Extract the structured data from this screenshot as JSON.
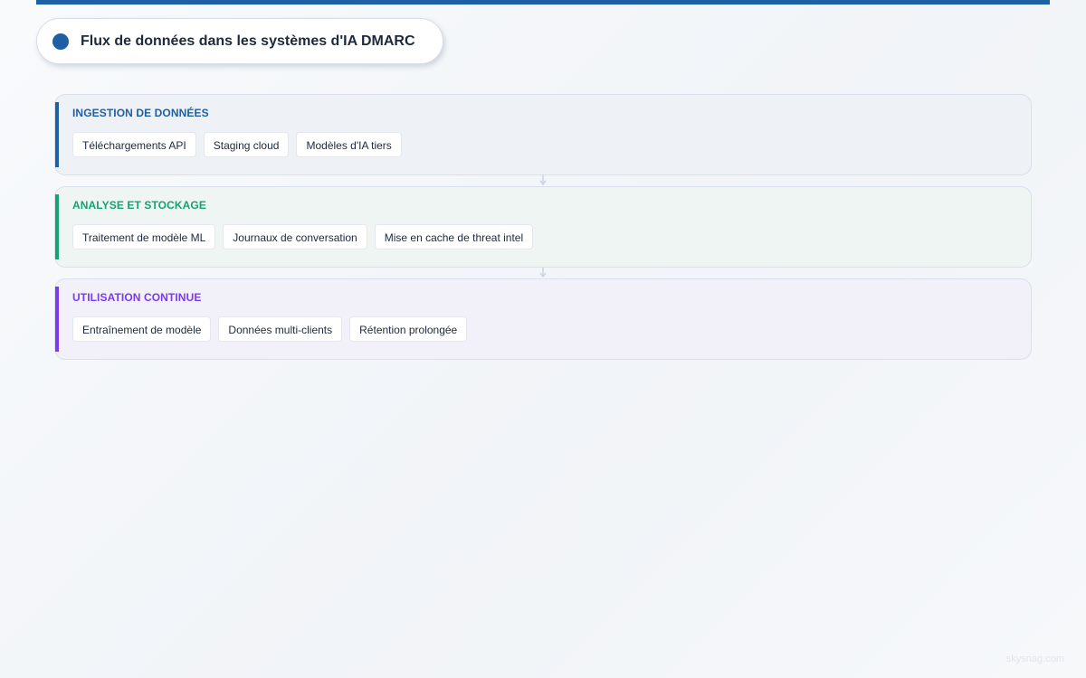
{
  "header": {
    "title": "Flux de données dans les systèmes d'IA DMARC"
  },
  "stages": [
    {
      "title": "Ingestion de données",
      "items": [
        "Téléchargements API",
        "Staging cloud",
        "Modèles d'IA tiers"
      ]
    },
    {
      "title": "Analyse et stockage",
      "items": [
        "Traitement de modèle ML",
        "Journaux de conversation",
        "Mise en cache de threat intel"
      ]
    },
    {
      "title": "Utilisation continue",
      "items": [
        "Entraînement de modèle",
        "Données multi-clients",
        "Rétention prolongée"
      ]
    }
  ],
  "watermark": "skysnag.com",
  "colors": {
    "brand": "#1f5fa3",
    "ingestion": "#1f5fa3",
    "analysis": "#17a272",
    "usage": "#7c3aed"
  }
}
